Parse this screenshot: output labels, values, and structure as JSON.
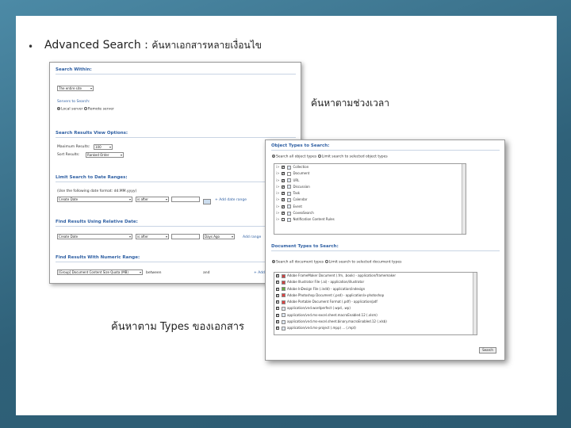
{
  "slide": {
    "bullet": "•",
    "heading_en": "Advanced Search :",
    "heading_th": "ค้นหาเอกสารหลายเงื่อนไข",
    "note_date": "ค้นหาตามช่วงเวลา",
    "note_types": "ค้นหาตาม   Types ของเอกสาร"
  },
  "search_form": {
    "search_within_title": "Search Within:",
    "search_within_value": "The entire site",
    "servers_label": "Servers to Search:",
    "servers_options": [
      "Local server",
      "Remote server"
    ],
    "view_options_title": "Search Results View Options:",
    "max_results_label": "Maximum Results:",
    "max_results_value": "100",
    "sort_results_label": "Sort Results:",
    "sort_results_value": "Ranked Order",
    "date_ranges_title": "Limit Search to Date Ranges:",
    "date_hint": "(Use the following date format: dd.MM.yyyy)",
    "date_field_value": "Create Date",
    "date_operator_value": "is after",
    "add_date_range": "+ Add date range",
    "relative_title": "Find Results Using Relative Date:",
    "relative_field_value": "Create Date",
    "relative_operator_value": "is after",
    "relative_unit_value": "Days Ago",
    "add_relative": "Add range",
    "numeric_title": "Find Results With Numeric Range:",
    "numeric_field_value": "[Group] Document Content Size Quota (MB)",
    "numeric_operator_value": "between",
    "numeric_and": "and",
    "numeric_add": "+ Add"
  },
  "types_panel": {
    "object_types_title": "Object Types to Search:",
    "object_scope_options": [
      "Search all object types",
      "Limit search to selected object types"
    ],
    "object_types": [
      {
        "label": "Collection",
        "checked": true,
        "icon": "folder-icon"
      },
      {
        "label": "Document",
        "checked": true,
        "icon": "document-icon"
      },
      {
        "label": "URL",
        "checked": true,
        "icon": "globe-icon"
      },
      {
        "label": "Discussion",
        "checked": true,
        "icon": "discussion-icon"
      },
      {
        "label": "Task",
        "checked": true,
        "icon": "task-icon"
      },
      {
        "label": "Calendar",
        "checked": true,
        "icon": "calendar-icon"
      },
      {
        "label": "Event",
        "checked": true,
        "icon": "event-icon"
      },
      {
        "label": "CoveoSearch",
        "checked": true,
        "icon": "search-icon"
      },
      {
        "label": "Notification Content Rules",
        "checked": false,
        "icon": "rules-icon"
      }
    ],
    "doc_types_title": "Document Types to Search:",
    "doc_scope_options": [
      "Search all document types",
      "Limit search to selected document types"
    ],
    "doc_types": [
      {
        "label": "Adobe FrameMaker Document (.fm, .book) - application/framemaker",
        "checked": true,
        "icon": "framemaker-icon"
      },
      {
        "label": "Adobe Illustrator File (.ai) - application/illustrator",
        "checked": true,
        "icon": "illustrator-icon"
      },
      {
        "label": "Adobe InDesign File (.indd) - application/indesign",
        "checked": true,
        "icon": "indesign-icon"
      },
      {
        "label": "Adobe Photoshop Document (.psd) - application/x-photoshop",
        "checked": true,
        "icon": "photoshop-icon"
      },
      {
        "label": "Adobe Portable Document Format (.pdf) - application/pdf",
        "checked": true,
        "icon": "pdf-icon"
      },
      {
        "label": "application/vnd.wordperfect (.wpd, .wp)",
        "checked": true,
        "icon": "wordperfect-icon"
      },
      {
        "label": "application/vnd.ms-excel.sheet.macroEnabled.12 (.xlsm)",
        "checked": true,
        "icon": "excel-icon"
      },
      {
        "label": "application/vnd.ms-excel.sheet.binary.macroEnabled.12 (.xlsb)",
        "checked": true,
        "icon": "excel-icon"
      },
      {
        "label": "application/vnd.ms-project (.mpp) ... (.mpt)",
        "checked": true,
        "icon": "project-icon"
      }
    ],
    "search_button": "Search"
  }
}
